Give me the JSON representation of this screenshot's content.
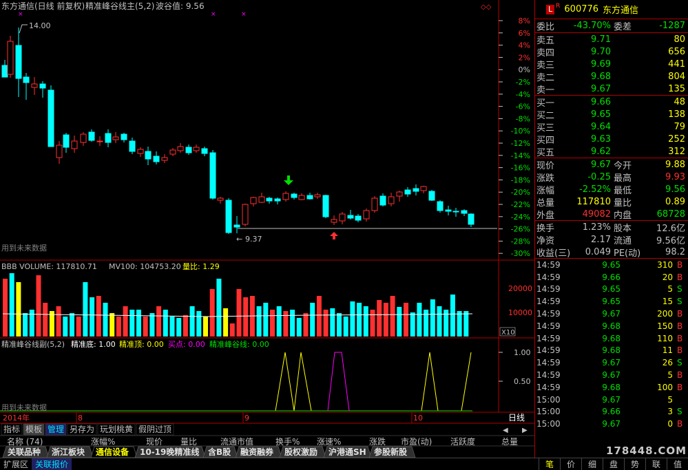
{
  "k_header": {
    "title": "东方通信(日线 前复权)",
    "ind": "精准峰谷线主(5,2)",
    "wave": "波谷值: 9.56"
  },
  "k_max_label": "14.00",
  "k_min_label": "9.37",
  "future": "用到未来数据",
  "pct_axis": [
    "8%",
    "6%",
    "4%",
    "2%",
    "0%",
    "-2%",
    "-4%",
    "-6%",
    "-8%",
    "-10%",
    "-12%",
    "-14%",
    "-16%",
    "-18%",
    "-20%",
    "-22%",
    "-24%",
    "-26%",
    "-28%",
    "-30%"
  ],
  "vol_header": {
    "name": "BBB VOLUME: 117810.71",
    "mv": "MV100: 104753.20",
    "ratio": "量比: 1.29"
  },
  "vol_axis": [
    "20000",
    "10000"
  ],
  "vol_unit": "X10",
  "ind2_header": {
    "name": "精准峰谷线副(5,2)",
    "bottom": "精准底: 1.00",
    "top": "精准顶: 0.00",
    "buy": "买点: 0.00",
    "line": "精准峰谷线: 0.00"
  },
  "ind2_axis": [
    "1.00",
    "0.50"
  ],
  "future2": "用到未来数据",
  "time_axis": [
    "2014年",
    "8",
    "9",
    "10"
  ],
  "period": "日线",
  "tabs1": [
    "指标",
    "模板",
    "管理",
    "另存为",
    "玩划桃黄",
    "假阴过顶"
  ],
  "table_header": [
    "名称 (74)",
    "涨幅%",
    "现价",
    "量比",
    "流通市值",
    "换手%",
    "涨速%",
    "涨跌",
    "市盈(动)",
    "活跃度",
    "总量"
  ],
  "block_tabs": [
    "关联品种",
    "浙江板块",
    "通信设备",
    "10-19晚精准线",
    "含B股",
    "融资融券",
    "股权激励",
    "沪港通SH",
    "参股新股"
  ],
  "bottom_tabs": [
    "扩展区",
    "关联报价"
  ],
  "bottom_btns": [
    "笔",
    "价",
    "细",
    "盘",
    "势",
    "联",
    "值"
  ],
  "watermark": "178448.COM",
  "quote": {
    "tag": "L",
    "sup": "R",
    "code": "600776",
    "name": "东方通信",
    "wb_label": "委比",
    "wb": "-43.70%",
    "wc_label": "委差",
    "wc": "-1287",
    "sells": [
      {
        "l": "卖五",
        "p": "9.71",
        "v": "80"
      },
      {
        "l": "卖四",
        "p": "9.70",
        "v": "656"
      },
      {
        "l": "卖三",
        "p": "9.69",
        "v": "441"
      },
      {
        "l": "卖二",
        "p": "9.68",
        "v": "804"
      },
      {
        "l": "卖一",
        "p": "9.67",
        "v": "135"
      }
    ],
    "buys": [
      {
        "l": "买一",
        "p": "9.66",
        "v": "48"
      },
      {
        "l": "买二",
        "p": "9.65",
        "v": "138"
      },
      {
        "l": "买三",
        "p": "9.64",
        "v": "79"
      },
      {
        "l": "买四",
        "p": "9.63",
        "v": "252"
      },
      {
        "l": "买五",
        "p": "9.62",
        "v": "312"
      }
    ],
    "info": [
      {
        "a": "现价",
        "av": "9.67",
        "ac": "#00e000",
        "b": "今开",
        "bv": "9.88",
        "bc": "#ffff00"
      },
      {
        "a": "涨跌",
        "av": "-0.25",
        "ac": "#00e000",
        "b": "最高",
        "bv": "9.93",
        "bc": "#ff3030"
      },
      {
        "a": "涨幅",
        "av": "-2.52%",
        "ac": "#00e000",
        "b": "最低",
        "bv": "9.56",
        "bc": "#00e000"
      },
      {
        "a": "总量",
        "av": "117810",
        "ac": "#ffff00",
        "b": "量比",
        "bv": "0.89",
        "bc": "#ffff00"
      },
      {
        "a": "外盘",
        "av": "49082",
        "ac": "#ff3030",
        "b": "内盘",
        "bv": "68728",
        "bc": "#00e000"
      }
    ],
    "info2": [
      {
        "a": "换手",
        "av": "1.23%",
        "b": "股本",
        "bv": "12.6亿"
      },
      {
        "a": "净资",
        "av": "2.17",
        "b": "流通",
        "bv": "9.56亿"
      },
      {
        "a": "收益(三)",
        "av": "0.049",
        "b": "PE(动)",
        "bv": "98.2"
      }
    ],
    "ticks": [
      {
        "t": "14:59",
        "p": "9.65",
        "v": "310",
        "s": "B"
      },
      {
        "t": "14:59",
        "p": "9.66",
        "v": "20",
        "s": "B"
      },
      {
        "t": "14:59",
        "p": "9.65",
        "v": "5",
        "s": "S"
      },
      {
        "t": "14:59",
        "p": "9.65",
        "v": "15",
        "s": "S"
      },
      {
        "t": "14:59",
        "p": "9.67",
        "v": "200",
        "s": "B"
      },
      {
        "t": "14:59",
        "p": "9.68",
        "v": "150",
        "s": "B"
      },
      {
        "t": "14:59",
        "p": "9.68",
        "v": "110",
        "s": "B"
      },
      {
        "t": "14:59",
        "p": "9.68",
        "v": "11",
        "s": "B"
      },
      {
        "t": "14:59",
        "p": "9.67",
        "v": "26",
        "s": "S"
      },
      {
        "t": "14:59",
        "p": "9.67",
        "v": "5",
        "s": "B"
      },
      {
        "t": "14:59",
        "p": "9.68",
        "v": "100",
        "s": "B"
      },
      {
        "t": "15:00",
        "p": "9.67",
        "v": "5",
        "s": ""
      },
      {
        "t": "15:00",
        "p": "9.66",
        "v": "3",
        "s": "S"
      },
      {
        "t": "15:00",
        "p": "9.67",
        "v": "0",
        "s": "B"
      }
    ]
  }
}
